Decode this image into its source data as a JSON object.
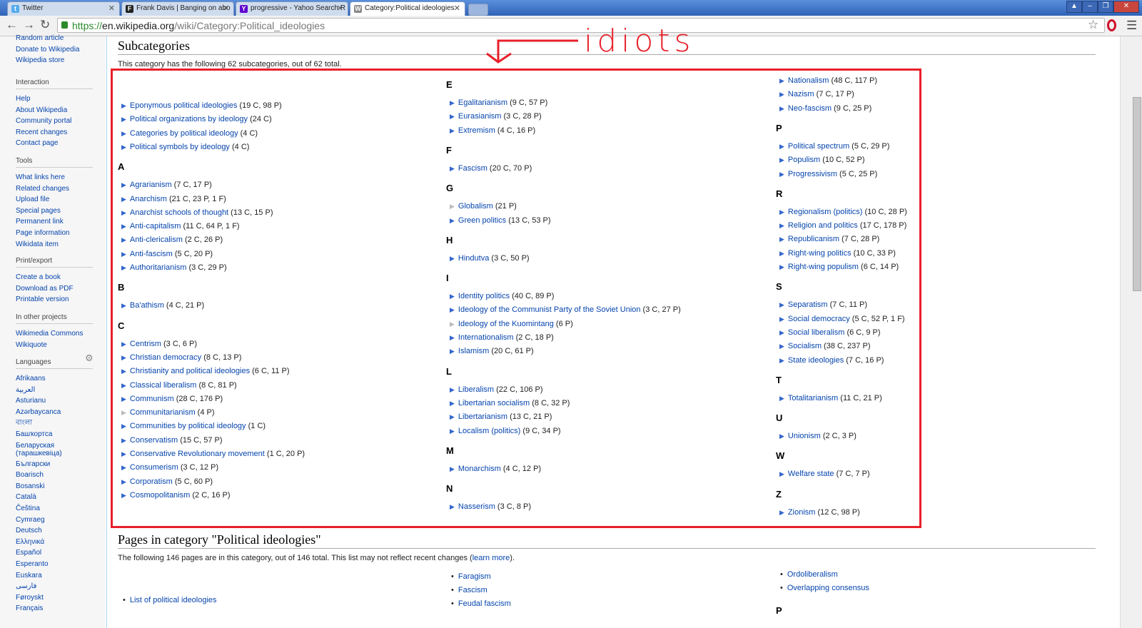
{
  "tabs": [
    {
      "label": "Twitter",
      "color": "#55acee",
      "glyph": "t"
    },
    {
      "label": "Frank Davis | Banging on abo",
      "color": "#222",
      "glyph": "F"
    },
    {
      "label": "progressive - Yahoo Search R",
      "color": "#5f01d1",
      "glyph": "Y"
    },
    {
      "label": "Category:Political ideologies",
      "color": "#888",
      "glyph": "W"
    }
  ],
  "address": {
    "scheme": "https://",
    "host": "en.wikipedia.org",
    "path": "/wiki/Category:Political_ideologies"
  },
  "sidebar": {
    "top_links": [
      "Random article",
      "Donate to Wikipedia",
      "Wikipedia store"
    ],
    "interaction": {
      "heading": "Interaction",
      "links": [
        "Help",
        "About Wikipedia",
        "Community portal",
        "Recent changes",
        "Contact page"
      ]
    },
    "tools": {
      "heading": "Tools",
      "links": [
        "What links here",
        "Related changes",
        "Upload file",
        "Special pages",
        "Permanent link",
        "Page information",
        "Wikidata item"
      ]
    },
    "print": {
      "heading": "Print/export",
      "links": [
        "Create a book",
        "Download as PDF",
        "Printable version"
      ]
    },
    "projects": {
      "heading": "In other projects",
      "links": [
        "Wikimedia Commons",
        "Wikiquote"
      ]
    },
    "languages": {
      "heading": "Languages",
      "links": [
        "Afrikaans",
        "العربية",
        "Asturianu",
        "Azərbaycanca",
        "বাংলা",
        "Башҡортса",
        "Беларуская (тарашкевіца)",
        "Български",
        "Boarisch",
        "Bosanski",
        "Català",
        "Čeština",
        "Cymraeg",
        "Deutsch",
        "Ελληνικά",
        "Español",
        "Esperanto",
        "Euskara",
        "فارسی",
        "Føroyskt",
        "Français"
      ]
    }
  },
  "subcats": {
    "heading": "Subcategories",
    "intro": "This category has the following 62 subcategories, out of 62 total.",
    "annotation": "idiots",
    "col1": [
      {
        "t": "item",
        "n": "Eponymous political ideologies",
        "c": "(19 C, 98 P)"
      },
      {
        "t": "item",
        "n": "Political organizations by ideology",
        "c": "(24 C)"
      },
      {
        "t": "item",
        "n": "Categories by political ideology",
        "c": "(4 C)"
      },
      {
        "t": "item",
        "n": "Political symbols by ideology",
        "c": "(4 C)"
      },
      {
        "t": "letter",
        "n": "A"
      },
      {
        "t": "item",
        "n": "Agrarianism",
        "c": "(7 C, 17 P)"
      },
      {
        "t": "item",
        "n": "Anarchism",
        "c": "(21 C, 23 P, 1 F)"
      },
      {
        "t": "item",
        "n": "Anarchist schools of thought",
        "c": "(13 C, 15 P)"
      },
      {
        "t": "item",
        "n": "Anti-capitalism",
        "c": "(11 C, 64 P, 1 F)"
      },
      {
        "t": "item",
        "n": "Anti-clericalism",
        "c": "(2 C, 26 P)"
      },
      {
        "t": "item",
        "n": "Anti-fascism",
        "c": "(5 C, 20 P)"
      },
      {
        "t": "item",
        "n": "Authoritarianism",
        "c": "(3 C, 29 P)"
      },
      {
        "t": "letter",
        "n": "B"
      },
      {
        "t": "item",
        "n": "Ba'athism",
        "c": "(4 C, 21 P)"
      },
      {
        "t": "letter",
        "n": "C"
      },
      {
        "t": "item",
        "n": "Centrism",
        "c": "(3 C, 6 P)"
      },
      {
        "t": "item",
        "n": "Christian democracy",
        "c": "(8 C, 13 P)"
      },
      {
        "t": "item",
        "n": "Christianity and political ideologies",
        "c": "(6 C, 11 P)"
      },
      {
        "t": "item",
        "n": "Classical liberalism",
        "c": "(8 C, 81 P)"
      },
      {
        "t": "item",
        "n": "Communism",
        "c": "(28 C, 176 P)"
      },
      {
        "t": "item",
        "n": "Communitarianism",
        "c": "(4 P)",
        "empty": true
      },
      {
        "t": "item",
        "n": "Communities by political ideology",
        "c": "(1 C)"
      },
      {
        "t": "item",
        "n": "Conservatism",
        "c": "(15 C, 57 P)"
      },
      {
        "t": "item",
        "n": "Conservative Revolutionary movement",
        "c": "(1 C, 20 P)"
      },
      {
        "t": "item",
        "n": "Consumerism",
        "c": "(3 C, 12 P)"
      },
      {
        "t": "item",
        "n": "Corporatism",
        "c": "(5 C, 60 P)"
      },
      {
        "t": "item",
        "n": "Cosmopolitanism",
        "c": "(2 C, 16 P)"
      }
    ],
    "col2": [
      {
        "t": "letter",
        "n": "E"
      },
      {
        "t": "item",
        "n": "Egalitarianism",
        "c": "(9 C, 57 P)"
      },
      {
        "t": "item",
        "n": "Eurasianism",
        "c": "(3 C, 28 P)"
      },
      {
        "t": "item",
        "n": "Extremism",
        "c": "(4 C, 16 P)"
      },
      {
        "t": "letter",
        "n": "F"
      },
      {
        "t": "item",
        "n": "Fascism",
        "c": "(20 C, 70 P)"
      },
      {
        "t": "letter",
        "n": "G"
      },
      {
        "t": "item",
        "n": "Globalism",
        "c": "(21 P)",
        "empty": true
      },
      {
        "t": "item",
        "n": "Green politics",
        "c": "(13 C, 53 P)"
      },
      {
        "t": "letter",
        "n": "H"
      },
      {
        "t": "item",
        "n": "Hindutva",
        "c": "(3 C, 50 P)"
      },
      {
        "t": "letter",
        "n": "I"
      },
      {
        "t": "item",
        "n": "Identity politics",
        "c": "(40 C, 89 P)"
      },
      {
        "t": "item",
        "n": "Ideology of the Communist Party of the Soviet Union",
        "c": "(3 C, 27 P)"
      },
      {
        "t": "item",
        "n": "Ideology of the Kuomintang",
        "c": "(6 P)",
        "empty": true
      },
      {
        "t": "item",
        "n": "Internationalism",
        "c": "(2 C, 18 P)"
      },
      {
        "t": "item",
        "n": "Islamism",
        "c": "(20 C, 61 P)"
      },
      {
        "t": "letter",
        "n": "L"
      },
      {
        "t": "item",
        "n": "Liberalism",
        "c": "(22 C, 106 P)"
      },
      {
        "t": "item",
        "n": "Libertarian socialism",
        "c": "(8 C, 32 P)"
      },
      {
        "t": "item",
        "n": "Libertarianism",
        "c": "(13 C, 21 P)"
      },
      {
        "t": "item",
        "n": "Localism (politics)",
        "c": "(9 C, 34 P)"
      },
      {
        "t": "letter",
        "n": "M"
      },
      {
        "t": "item",
        "n": "Monarchism",
        "c": "(4 C, 12 P)"
      },
      {
        "t": "letter",
        "n": "N"
      },
      {
        "t": "item",
        "n": "Nasserism",
        "c": "(3 C, 8 P)"
      }
    ],
    "col3": [
      {
        "t": "item",
        "n": "Nationalism",
        "c": "(48 C, 117 P)"
      },
      {
        "t": "item",
        "n": "Nazism",
        "c": "(7 C, 17 P)"
      },
      {
        "t": "item",
        "n": "Neo-fascism",
        "c": "(9 C, 25 P)"
      },
      {
        "t": "letter",
        "n": "P"
      },
      {
        "t": "item",
        "n": "Political spectrum",
        "c": "(5 C, 29 P)"
      },
      {
        "t": "item",
        "n": "Populism",
        "c": "(10 C, 52 P)"
      },
      {
        "t": "item",
        "n": "Progressivism",
        "c": "(5 C, 25 P)"
      },
      {
        "t": "letter",
        "n": "R"
      },
      {
        "t": "item",
        "n": "Regionalism (politics)",
        "c": "(10 C, 28 P)"
      },
      {
        "t": "item",
        "n": "Religion and politics",
        "c": "(17 C, 178 P)"
      },
      {
        "t": "item",
        "n": "Republicanism",
        "c": "(7 C, 28 P)"
      },
      {
        "t": "item",
        "n": "Right-wing politics",
        "c": "(10 C, 33 P)"
      },
      {
        "t": "item",
        "n": "Right-wing populism",
        "c": "(6 C, 14 P)"
      },
      {
        "t": "letter",
        "n": "S"
      },
      {
        "t": "item",
        "n": "Separatism",
        "c": "(7 C, 11 P)"
      },
      {
        "t": "item",
        "n": "Social democracy",
        "c": "(5 C, 52 P, 1 F)"
      },
      {
        "t": "item",
        "n": "Social liberalism",
        "c": "(6 C, 9 P)"
      },
      {
        "t": "item",
        "n": "Socialism",
        "c": "(38 C, 237 P)"
      },
      {
        "t": "item",
        "n": "State ideologies",
        "c": "(7 C, 16 P)"
      },
      {
        "t": "letter",
        "n": "T"
      },
      {
        "t": "item",
        "n": "Totalitarianism",
        "c": "(11 C, 21 P)"
      },
      {
        "t": "letter",
        "n": "U"
      },
      {
        "t": "item",
        "n": "Unionism",
        "c": "(2 C, 3 P)"
      },
      {
        "t": "letter",
        "n": "W"
      },
      {
        "t": "item",
        "n": "Welfare state",
        "c": "(7 C, 7 P)"
      },
      {
        "t": "letter",
        "n": "Z"
      },
      {
        "t": "item",
        "n": "Zionism",
        "c": "(12 C, 98 P)"
      }
    ]
  },
  "pages": {
    "heading": "Pages in category \"Political ideologies\"",
    "intro": "The following 146 pages are in this category, out of 146 total. This list may not reflect recent changes (",
    "learn_more": "learn more",
    "intro_end": ").",
    "col1": [
      "List of political ideologies"
    ],
    "col2": [
      "Faragism",
      "Fascism",
      "Feudal fascism"
    ],
    "col3": [
      "Ordoliberalism",
      "Overlapping consensus"
    ],
    "col3_letter": "P"
  }
}
